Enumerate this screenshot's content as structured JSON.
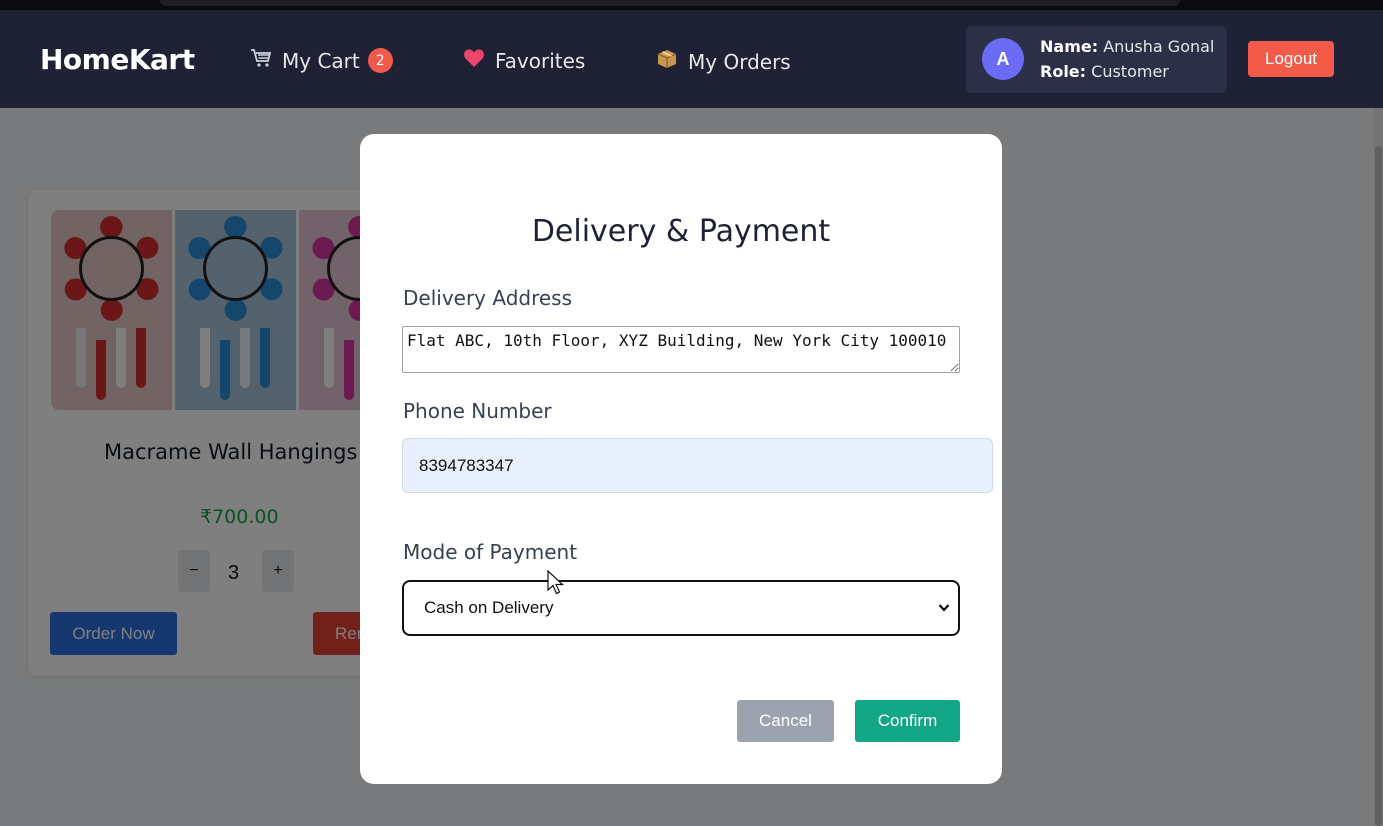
{
  "navbar": {
    "logo": "HomeKart",
    "links": [
      {
        "label": "My Cart",
        "icon": "cart-icon",
        "badge": "2"
      },
      {
        "label": "Favorites",
        "icon": "heart-icon"
      },
      {
        "label": "My Orders",
        "icon": "package-icon"
      }
    ],
    "user": {
      "avatar_initial": "A",
      "name_label": "Name:",
      "name": "Anusha Gonal",
      "role_label": "Role:",
      "role": "Customer"
    },
    "logout_label": "Logout"
  },
  "product": {
    "title": "Macrame Wall Hangings",
    "price": "₹700.00",
    "quantity": "3",
    "minus_label": "−",
    "plus_label": "+",
    "order_label": "Order Now",
    "remove_label": "Remove"
  },
  "modal": {
    "title": "Delivery & Payment",
    "address_label": "Delivery Address",
    "address_value": "Flat ABC, 10th Floor, XYZ Building, New York City 100010",
    "phone_label": "Phone Number",
    "phone_value": "8394783347",
    "payment_label": "Mode of Payment",
    "payment_selected": "Cash on Delivery",
    "cancel_label": "Cancel",
    "confirm_label": "Confirm"
  },
  "colors": {
    "navbar_bg": "#1f2235",
    "accent_red": "#f25a4a",
    "order_blue": "#2f6fe0",
    "confirm_green": "#12a586",
    "cancel_gray": "#9ca3af",
    "price_green": "#16a34a"
  }
}
